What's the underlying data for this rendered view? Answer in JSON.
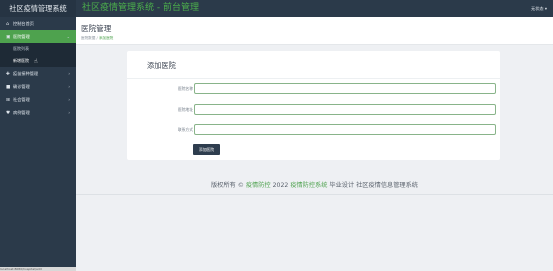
{
  "sidebar": {
    "brand": "社区疫情管理系统",
    "items": [
      {
        "label": "控制台首页",
        "icon": "home-icon",
        "glyph": "⌂"
      },
      {
        "label": "医院管理",
        "icon": "hospital-icon",
        "glyph": "▣",
        "arrow": "⌄"
      },
      {
        "label": "疫苗接种管理",
        "icon": "syringe-icon",
        "glyph": "✚",
        "arrow": "›"
      },
      {
        "label": "确诊管理",
        "icon": "truck-icon",
        "glyph": "■",
        "arrow": "›"
      },
      {
        "label": "社会管理",
        "icon": "plus-square-icon",
        "glyph": "⊞",
        "arrow": "›"
      },
      {
        "label": "病例管理",
        "icon": "heart-icon",
        "glyph": "♥",
        "arrow": "›"
      }
    ],
    "sub_items": [
      "医院列表",
      "新增医院"
    ],
    "status_url": "localhost:8080/hospital/add"
  },
  "topbar": {
    "title": "社区疫情管理系统 - 前台管理",
    "user": "无状态 ▾"
  },
  "header": {
    "title": "医院管理",
    "crumb_home": "医院数据",
    "crumb_sep": "/",
    "crumb_current": "添加医院"
  },
  "form": {
    "title": "添加医院",
    "fields": [
      {
        "label": "医院名称",
        "value": ""
      },
      {
        "label": "医院地址",
        "value": ""
      },
      {
        "label": "联系方式",
        "value": ""
      }
    ],
    "submit_label": "添加医院"
  },
  "footer": {
    "prefix": "版权所有 ©",
    "link1": "疫情防控",
    "middle": "2022",
    "link2": "疫情防控系统",
    "suffix": "毕业设计 社区疫情信息管理系统"
  },
  "colors": {
    "sidebar": "#2b3a4a",
    "accent": "#4ea24e",
    "page_bg": "#eef0f3"
  }
}
